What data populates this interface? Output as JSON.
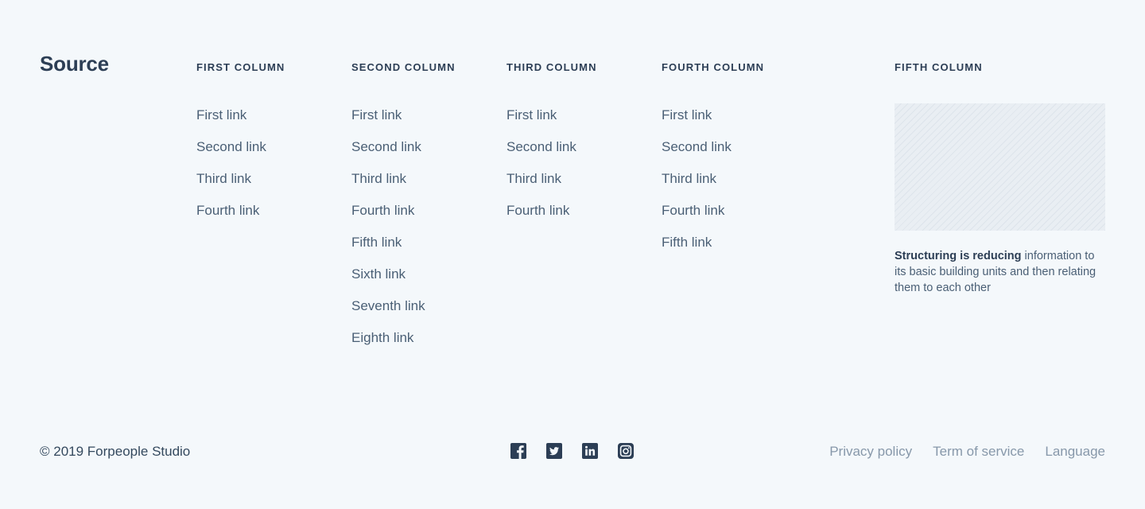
{
  "brand": {
    "logo_text": "Source"
  },
  "columns": [
    {
      "heading": "FIRST COLUMN",
      "links": [
        "First link",
        "Second link",
        "Third link",
        "Fourth link"
      ]
    },
    {
      "heading": "SECOND COLUMN",
      "links": [
        "First link",
        "Second link",
        "Third link",
        "Fourth link",
        "Fifth link",
        "Sixth link",
        "Seventh link",
        "Eighth link"
      ]
    },
    {
      "heading": "THIRD COLUMN",
      "links": [
        "First link",
        "Second link",
        "Third link",
        "Fourth link"
      ]
    },
    {
      "heading": "FOURTH COLUMN",
      "links": [
        "First link",
        "Second link",
        "Third link",
        "Fourth link",
        "Fifth link"
      ]
    }
  ],
  "fifth_column": {
    "heading": "FIFTH COLUMN",
    "blurb_bold": "Structuring is reducing",
    "blurb_rest": "information to its basic building units and then relating them to each other"
  },
  "footer": {
    "copyright": "© 2019 Forpeople Studio",
    "social_icons": [
      "facebook-icon",
      "twitter-icon",
      "linkedin-icon",
      "instagram-icon"
    ],
    "legal_links": [
      "Privacy policy",
      "Term of service",
      "Language"
    ]
  },
  "colors": {
    "background": "#f4f8fb",
    "heading": "#2c3e55",
    "link": "#4a5f75",
    "muted_link": "#8798aa",
    "icon": "#2c3e55"
  }
}
